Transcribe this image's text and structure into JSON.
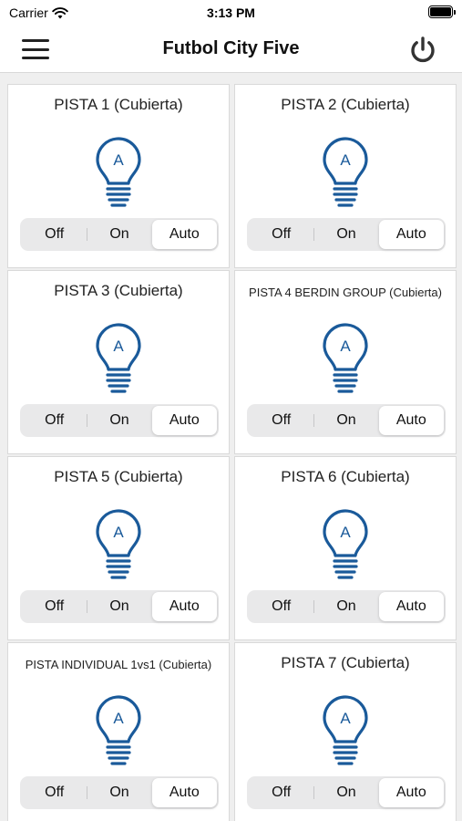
{
  "status_bar": {
    "carrier": "Carrier",
    "time": "3:13 PM"
  },
  "nav": {
    "title": "Futbol City Five"
  },
  "colors": {
    "accent": "#1a5a9a",
    "selected_bg": "#ffffff",
    "segment_bg": "#e9e9ea"
  },
  "bulb_letter": "A",
  "cards": [
    {
      "title": "PISTA 1 (Cubierta)",
      "options": [
        "Off",
        "On",
        "Auto"
      ],
      "selected": "Auto"
    },
    {
      "title": "PISTA 2 (Cubierta)",
      "options": [
        "Off",
        "On",
        "Auto"
      ],
      "selected": "Auto"
    },
    {
      "title": "PISTA 3 (Cubierta)",
      "options": [
        "Off",
        "On",
        "Auto"
      ],
      "selected": "Auto"
    },
    {
      "title": "PISTA 4  BERDIN GROUP (Cubierta)",
      "options": [
        "Off",
        "On",
        "Auto"
      ],
      "selected": "Auto"
    },
    {
      "title": "PISTA 5 (Cubierta)",
      "options": [
        "Off",
        "On",
        "Auto"
      ],
      "selected": "Auto"
    },
    {
      "title": "PISTA 6 (Cubierta)",
      "options": [
        "Off",
        "On",
        "Auto"
      ],
      "selected": "Auto"
    },
    {
      "title": "PISTA INDIVIDUAL 1vs1 (Cubierta)",
      "options": [
        "Off",
        "On",
        "Auto"
      ],
      "selected": "Auto"
    },
    {
      "title": "PISTA 7 (Cubierta)",
      "options": [
        "Off",
        "On",
        "Auto"
      ],
      "selected": "Auto"
    }
  ]
}
